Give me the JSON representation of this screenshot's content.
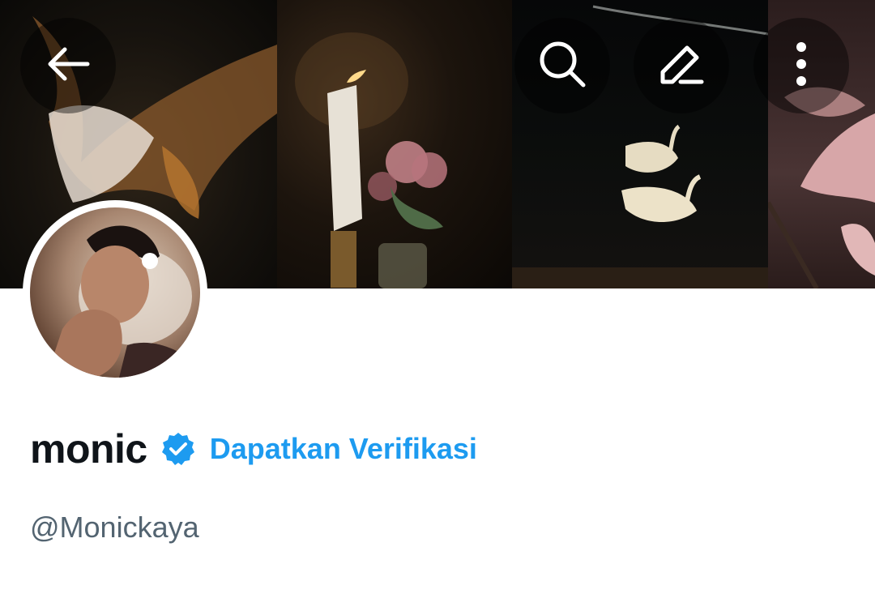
{
  "header": {
    "back_icon": "arrow-left-icon",
    "search_icon": "search-icon",
    "edit_icon": "pencil-icon",
    "more_icon": "more-vertical-icon"
  },
  "profile": {
    "display_name": "monic",
    "verified_icon": "verified-badge-icon",
    "get_verified_label": "Dapatkan Verifikasi",
    "handle": "@Monickaya"
  },
  "colors": {
    "accent": "#1d9bf0",
    "name_text": "#0f1419",
    "secondary_text": "#536471"
  }
}
